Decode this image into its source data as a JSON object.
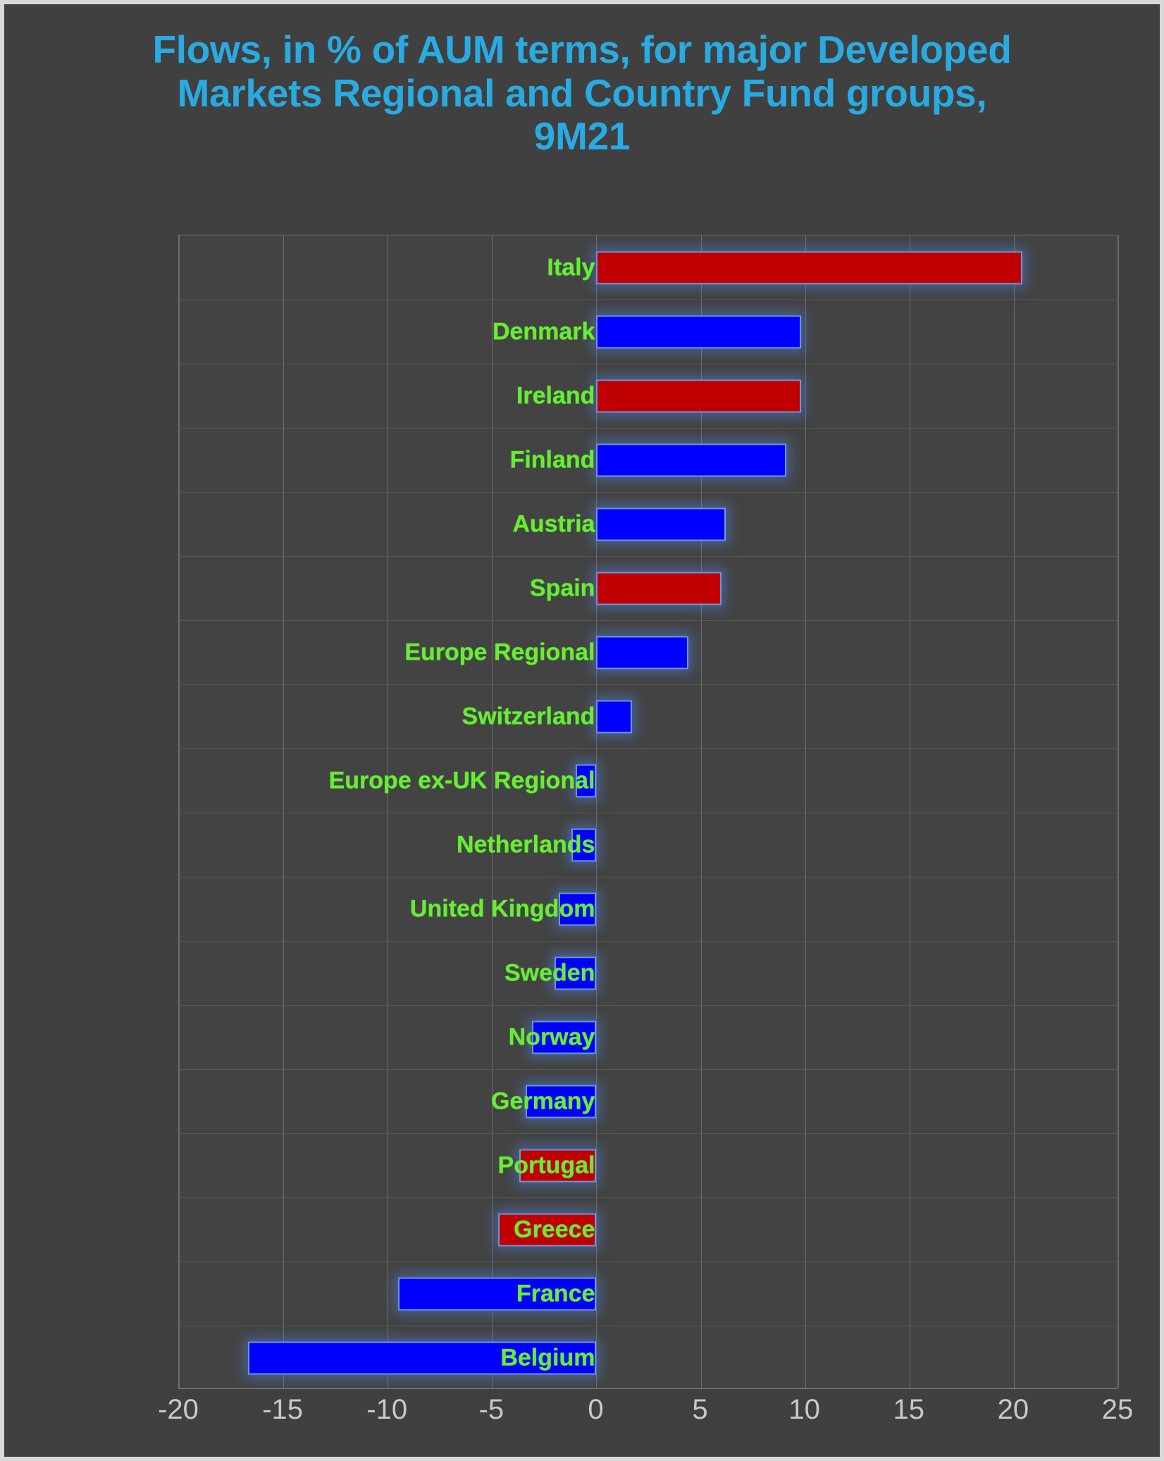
{
  "title": "Flows, in % of AUM terms, for major Developed\nMarkets Regional and Country Fund groups,\n9M21",
  "colors": {
    "title": "#29ABE2",
    "background": "#404040",
    "plot_background": "#434343",
    "positive_bar": "#C00000",
    "negative_bar": "#0000FF",
    "bar_outline": "#6F94D6",
    "category_label": "#66EE33",
    "tick_label": "#C9C9C9",
    "gridline": "#6E6E6E"
  },
  "axis": {
    "ticks": [
      "-20",
      "-15",
      "-10",
      "-5",
      "0",
      "5",
      "10",
      "15",
      "20",
      "25"
    ],
    "tick_values": [
      -20,
      -15,
      -10,
      -5,
      0,
      5,
      10,
      15,
      20,
      25
    ],
    "min": -20,
    "max": 25
  },
  "chart_data": {
    "type": "bar",
    "orientation": "horizontal",
    "title": "Flows, in % of AUM terms, for major Developed Markets Regional and Country Fund groups, 9M21",
    "xlabel": "",
    "ylabel": "",
    "xlim": [
      -20,
      25
    ],
    "grid": true,
    "legend": "none",
    "categories": [
      "Italy",
      "Denmark",
      "Ireland",
      "Finland",
      "Austria",
      "Spain",
      "Europe Regional",
      "Switzerland",
      "Europe ex-UK Regional",
      "Netherlands",
      "United Kingdom",
      "Sweden",
      "Norway",
      "Germany",
      "Portugal",
      "Greece",
      "France",
      "Belgium"
    ],
    "values": [
      20.4,
      9.8,
      9.8,
      9.1,
      6.2,
      6.0,
      4.4,
      1.7,
      -1.0,
      -1.2,
      -1.8,
      -2.0,
      -3.1,
      -3.4,
      -3.7,
      -4.7,
      -9.5,
      -16.7
    ],
    "bar_colors": [
      "#C00000",
      "#0000FF",
      "#C00000",
      "#0000FF",
      "#0000FF",
      "#C00000",
      "#0000FF",
      "#0000FF",
      "#0000FF",
      "#0000FF",
      "#0000FF",
      "#0000FF",
      "#0000FF",
      "#0000FF",
      "#C00000",
      "#C00000",
      "#0000FF",
      "#0000FF"
    ]
  }
}
